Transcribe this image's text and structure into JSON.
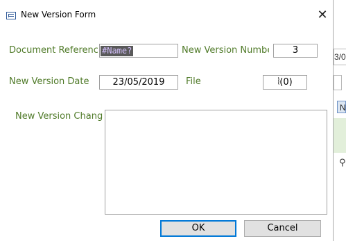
{
  "dialog": {
    "title": "New Version Form",
    "close_glyph": "X"
  },
  "form": {
    "doc_ref_label": "Document Reference",
    "doc_ref_value": "#Name?",
    "new_version_number_label": "New Version Number",
    "new_version_number_value": "3",
    "new_version_date_label": "New Version Date",
    "new_version_date_value": "23/05/2019",
    "file_label": "File",
    "file_value": "(0)",
    "changes_label": "New Version Changes",
    "changes_value": ""
  },
  "buttons": {
    "ok": "OK",
    "cancel": "Cancel"
  },
  "background": {
    "right_field_text": "3/0",
    "right_tab_text": "N"
  },
  "icons": {
    "form": "form-icon",
    "attachment": "paperclip-icon",
    "close": "close-icon"
  },
  "colors": {
    "label_green": "#4f7a28",
    "error_bg": "#595959",
    "error_fg": "#d6c2ff",
    "focus_blue": "#0078d7"
  }
}
